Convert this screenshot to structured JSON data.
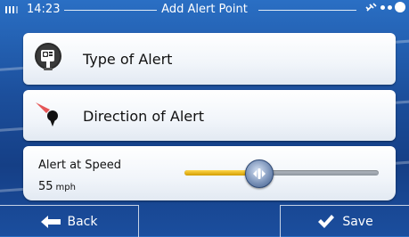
{
  "status": {
    "time": "14:23",
    "title": "Add Alert Point"
  },
  "options": [
    {
      "label": "Type of Alert",
      "icon": "speed-camera-icon"
    },
    {
      "label": "Direction of Alert",
      "icon": "direction-pin-icon"
    }
  ],
  "speed": {
    "label": "Alert at Speed",
    "value": "55",
    "unit": "mph",
    "slider_fraction": 0.38
  },
  "buttons": {
    "back": "Back",
    "save": "Save"
  },
  "colors": {
    "background": "#1c4f9c",
    "slider_fill": "#f2c31a",
    "accent": "#ffffff"
  }
}
